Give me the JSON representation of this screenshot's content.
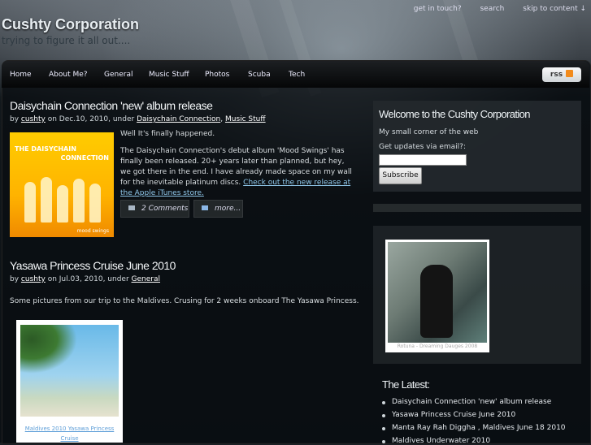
{
  "site": {
    "title": "Cushty Corporation",
    "tagline": "trying to figure it all out...."
  },
  "toplinks": [
    "get in touch?",
    "search",
    "skip to content ↓"
  ],
  "nav": {
    "items": [
      "Home",
      "About Me?",
      "General",
      "Music Stuff",
      "Photos",
      "Scuba",
      "Tech"
    ],
    "rss_label": "rss"
  },
  "posts": [
    {
      "title": "Daisychain Connection 'new' album release",
      "by": "by",
      "author": "cushty",
      "on": "on Dec.10, 2010, under",
      "cat1": "Daisychain Connection",
      "sep": ",",
      "cat2": "Music Stuff",
      "p1": "Well It's finally happened.",
      "p2": "The Daisychain Connection's debut album 'Mood Swings' has finally been released. 20+ years later than planned, but hey, we got there in the end. I have already made space on my wall for the inevitable platinum discs.",
      "link": "Check out the new release at the Apple iTunes store.",
      "album_band": "THE DAISYCHAIN",
      "album_band2": "CONNECTION",
      "album_sub": "mood swings",
      "comments": "2 Comments",
      "more": "more..."
    },
    {
      "title": "Yasawa Princess Cruise June 2010",
      "by": "by",
      "author": "cushty",
      "on": "on Jul.03, 2010, under",
      "cat1": "General",
      "p1": "Some pictures from our trip to the Maldives. Crusing for 2 weeks onboard The Yasawa Princess.",
      "photo_caption": "Maldives 2010 Yasawa Princess Cruise"
    }
  ],
  "sidebar": {
    "welcome_title": "Welcome to the Cushty Corporation",
    "welcome_text": "My small corner of the web",
    "email_label": "Get updates via email?:",
    "subscribe_label": "Subscribe",
    "photo_caption": "Rotuna - Dreaming Dauges 2008",
    "latest_title": "The Latest:",
    "latest": [
      "Daisychain Connection 'new' album release",
      "Yasawa Princess Cruise June 2010",
      "Manta Ray Rah Diggha , Maldives June 18 2010",
      "Maldives Underwater 2010"
    ]
  }
}
